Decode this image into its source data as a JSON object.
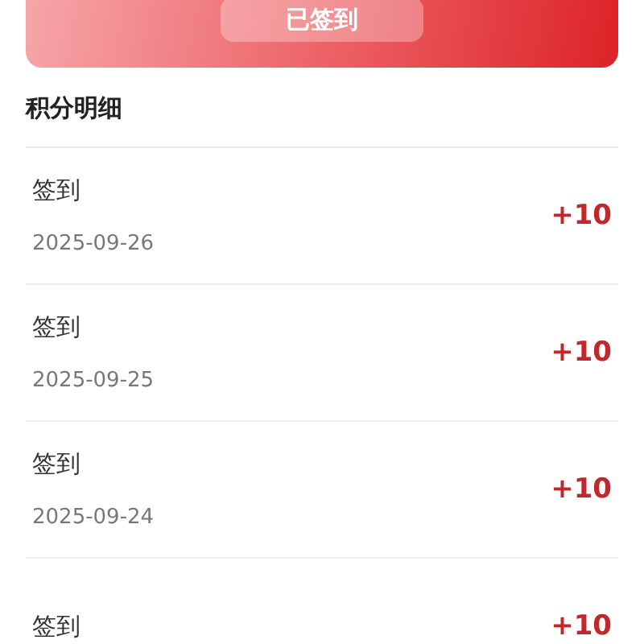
{
  "checkin_card": {
    "button": "已签到"
  },
  "section_title": "积分明细",
  "records": [
    {
      "title": "签到",
      "date": "2025-09-26",
      "points": "+10"
    },
    {
      "title": "签到",
      "date": "2025-09-25",
      "points": "+10"
    },
    {
      "title": "签到",
      "date": "2025-09-24",
      "points": "+10"
    },
    {
      "title": "签到",
      "points": "+10"
    }
  ]
}
